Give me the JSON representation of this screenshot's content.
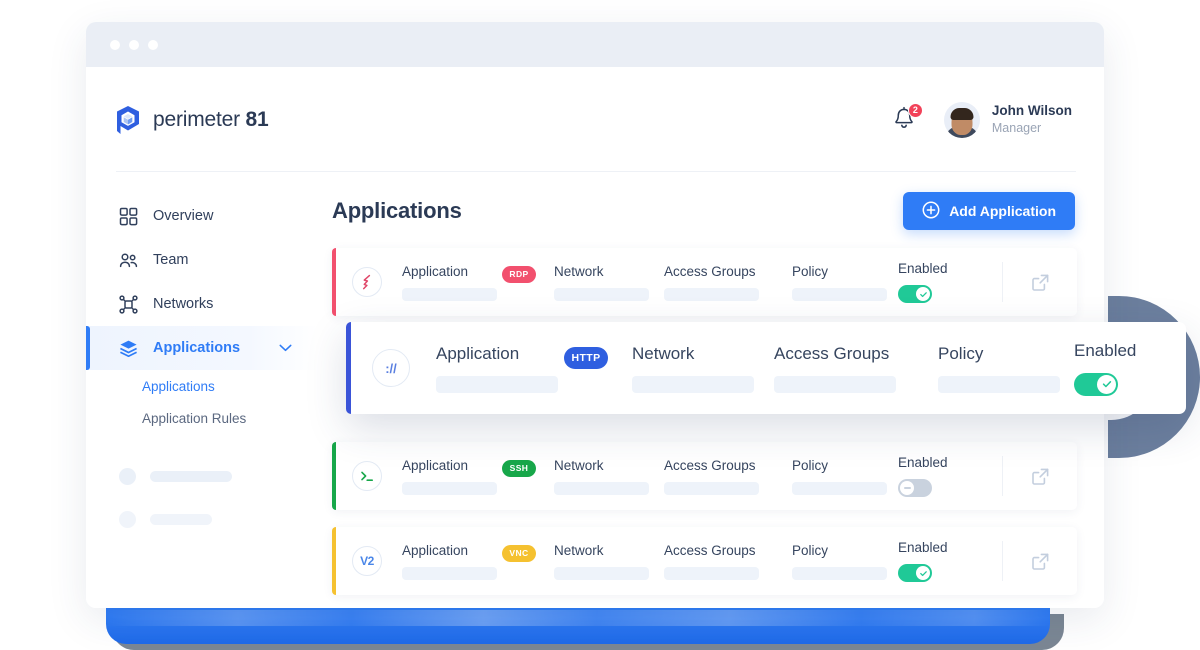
{
  "window": {
    "traffic_lights": [
      "close",
      "minimize",
      "zoom"
    ]
  },
  "header": {
    "brand_prefix": "perimeter ",
    "brand_suffix": "81",
    "logo_icon": "cube-shield-icon",
    "notifications": {
      "icon": "bell-icon",
      "count": "2"
    },
    "user": {
      "name": "John Wilson",
      "role": "Manager",
      "avatar_icon": "user-avatar"
    }
  },
  "sidebar": {
    "items": [
      {
        "label": "Overview",
        "icon": "grid-icon",
        "active": false
      },
      {
        "label": "Team",
        "icon": "people-icon",
        "active": false
      },
      {
        "label": "Networks",
        "icon": "network-nodes-icon",
        "active": false
      },
      {
        "label": "Applications",
        "icon": "layers-icon",
        "active": true,
        "chevron": "chevron-down-icon"
      }
    ],
    "subitems": [
      {
        "label": "Applications",
        "active": true
      },
      {
        "label": "Application Rules",
        "active": false
      }
    ],
    "placeholders": 2
  },
  "main": {
    "page_title": "Applications",
    "add_button": {
      "label": "Add Application",
      "icon": "plus-circle-icon",
      "color": "#2f7cf6"
    },
    "column_headers": {
      "application": "Application",
      "network": "Network",
      "access_groups": "Access Groups",
      "policy": "Policy",
      "enabled": "Enabled"
    },
    "rows": [
      {
        "protocol": "RDP",
        "protocol_color": "#f2506e",
        "accent_color": "#f2506e",
        "app_icon": "rdp-bolt-icon",
        "enabled": true,
        "link_icon": "external-link-icon",
        "elevated": false
      },
      {
        "protocol": "HTTP",
        "protocol_color": "#2f5fe0",
        "accent_color": "#3a54d8",
        "app_icon": "http-slashes-icon",
        "enabled": true,
        "link_icon": "external-link-icon",
        "elevated": true
      },
      {
        "protocol": "SSH",
        "protocol_color": "#17a74a",
        "accent_color": "#17a74a",
        "app_icon": "ssh-terminal-icon",
        "enabled": false,
        "link_icon": "external-link-icon",
        "elevated": false
      },
      {
        "protocol": "VNC",
        "protocol_color": "#f5c130",
        "accent_color": "#f5c130",
        "app_icon": "vnc-v2-icon",
        "enabled": true,
        "link_icon": "external-link-icon",
        "elevated": false
      }
    ]
  },
  "decor": {
    "shape": "letter-d-shape",
    "shape_color": "#6c7f9e",
    "laptop_base_color": "#2f7cf6"
  }
}
